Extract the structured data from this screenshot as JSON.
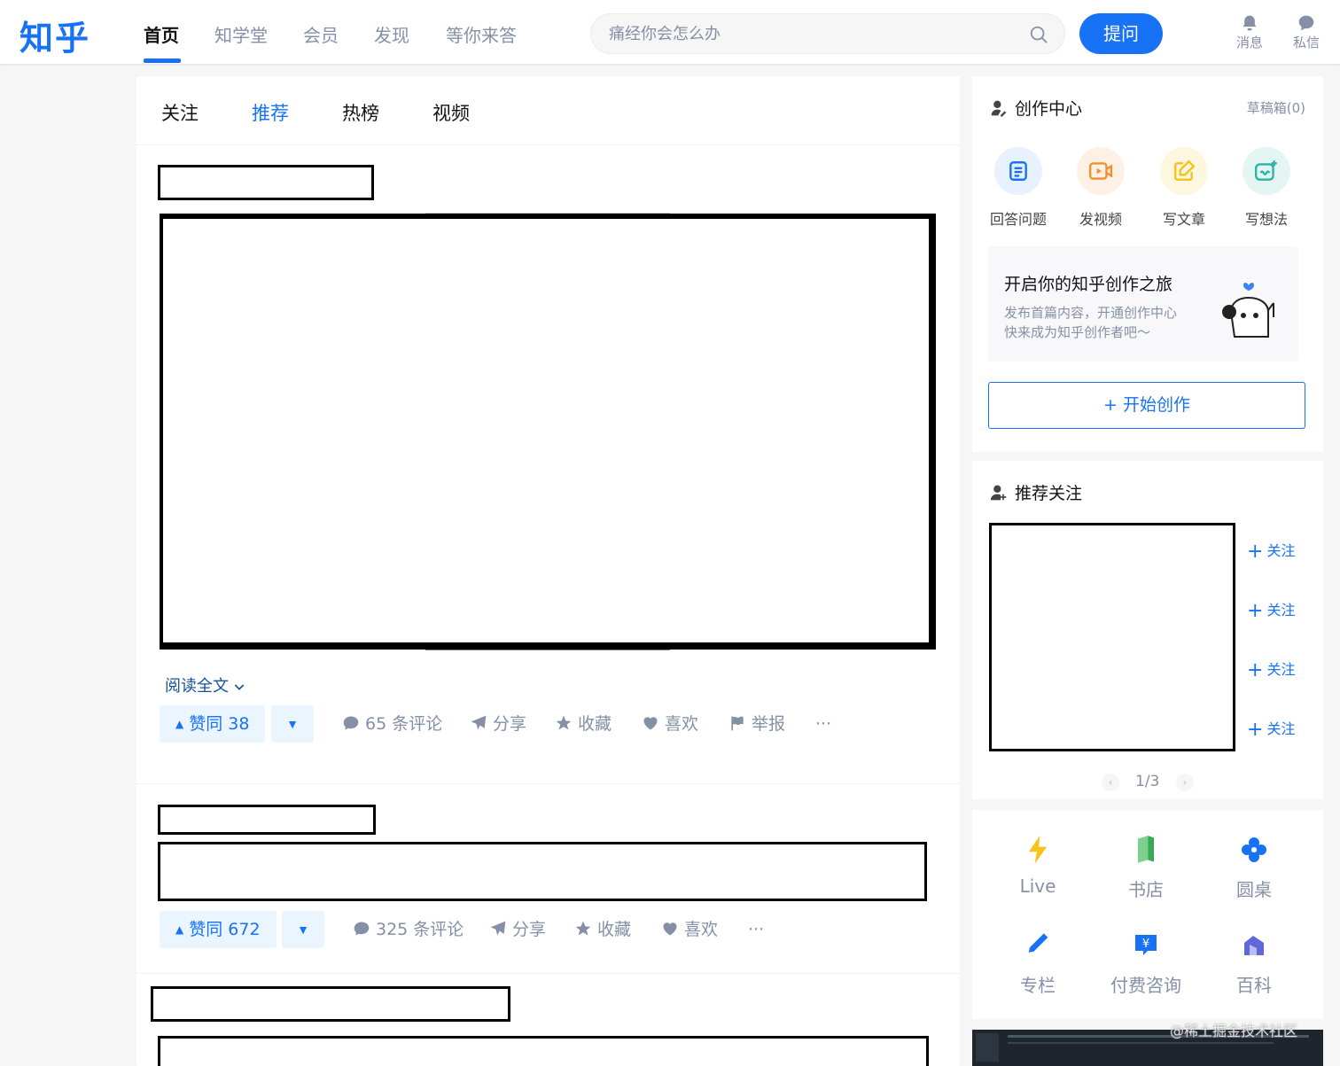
{
  "header": {
    "logo": "知乎",
    "nav": [
      "首页",
      "知学堂",
      "会员",
      "发现",
      "等你来答"
    ],
    "search_placeholder": "痛经你会怎么办",
    "ask_label": "提问",
    "messages_label": "消息",
    "dm_label": "私信"
  },
  "feed": {
    "tabs": [
      "关注",
      "推荐",
      "热榜",
      "视频"
    ],
    "read_more": "阅读全文",
    "items": [
      {
        "upvote_label": "赞同 38",
        "comments_label": "65 条评论",
        "share_label": "分享",
        "collect_label": "收藏",
        "like_label": "喜欢",
        "report_label": "举报",
        "more_label": "···"
      },
      {
        "upvote_label": "赞同 672",
        "comments_label": "325 条评论",
        "share_label": "分享",
        "collect_label": "收藏",
        "like_label": "喜欢",
        "more_label": "···"
      }
    ]
  },
  "creation": {
    "title": "创作中心",
    "drafts": "草稿箱(0)",
    "items": [
      {
        "label": "回答问题",
        "color": "#1772f6",
        "bg": "#e8f1fe",
        "icon": "answer-icon"
      },
      {
        "label": "发视频",
        "color": "#f4902a",
        "bg": "#fdf1e5",
        "icon": "video-icon"
      },
      {
        "label": "写文章",
        "color": "#f5c21c",
        "bg": "#fdf7e0",
        "icon": "article-icon"
      },
      {
        "label": "写想法",
        "color": "#27b5a5",
        "bg": "#e4f6f3",
        "icon": "idea-icon"
      }
    ],
    "promo_title": "开启你的知乎创作之旅",
    "promo_line1": "发布首篇内容，开通创作中心",
    "promo_line2": "快来成为知乎创作者吧～",
    "start_label": "+ 开始创作"
  },
  "recommend": {
    "title": "推荐关注",
    "follow_label": "关注",
    "pager": "1/3"
  },
  "tools": [
    {
      "label": "Live",
      "icon": "lightning-icon",
      "color": "#f9c21f"
    },
    {
      "label": "书店",
      "icon": "book-icon",
      "color": "#4cbf6e"
    },
    {
      "label": "圆桌",
      "icon": "roundtable-icon",
      "color": "#1772f6"
    },
    {
      "label": "专栏",
      "icon": "pen-icon",
      "color": "#1772f6"
    },
    {
      "label": "付费咨询",
      "icon": "consult-icon",
      "color": "#1772f6"
    },
    {
      "label": "百科",
      "icon": "wiki-icon",
      "color": "#5f67d9"
    }
  ],
  "watermark": "@稀土掘金技术社区"
}
